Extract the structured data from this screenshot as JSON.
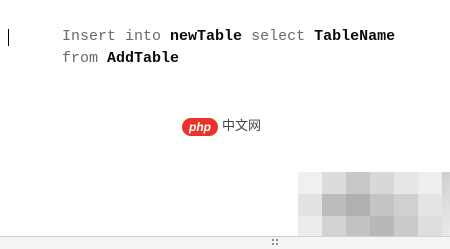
{
  "editor": {
    "lines": [
      [
        {
          "text": "Insert into ",
          "style": "plain"
        },
        {
          "text": "newTable",
          "style": "bold"
        },
        {
          "text": " select ",
          "style": "plain"
        },
        {
          "text": "TableName",
          "style": "bold"
        }
      ],
      [
        {
          "text": "from ",
          "style": "plain"
        },
        {
          "text": "AddTable",
          "style": "bold"
        }
      ]
    ],
    "caret_line": 1
  },
  "watermark": {
    "badge_text": "php",
    "text": "中文网",
    "badge_color": "#e9342a"
  },
  "statusbar": {
    "grip_icon": "resize-grip-icon"
  }
}
